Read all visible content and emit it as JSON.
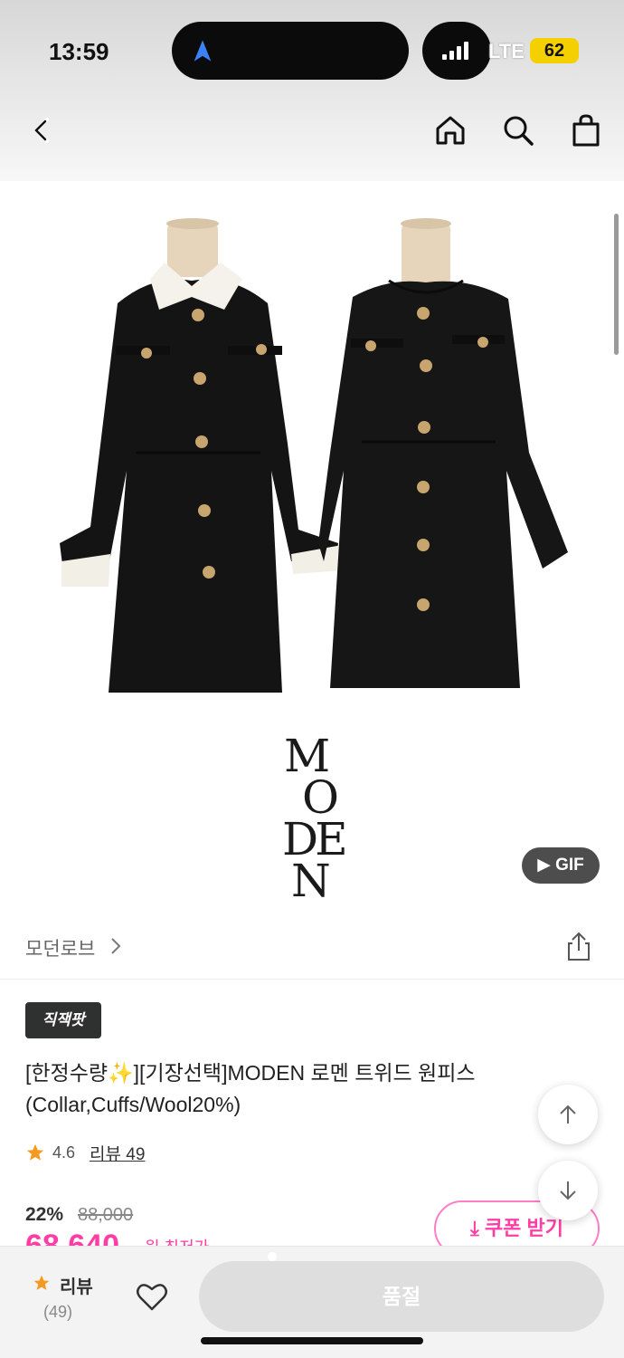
{
  "status_bar": {
    "time": "13:59",
    "network": "LTE",
    "battery": "62",
    "nav_icon": "location-arrow-icon",
    "colors": {
      "battery": "#f5d000",
      "nav": "#3b82f6"
    }
  },
  "header": {
    "icons": [
      "back-icon",
      "home-icon",
      "search-icon",
      "shopping-bag-icon"
    ]
  },
  "image": {
    "logo_lines": [
      "M",
      "O",
      "DE",
      "N"
    ],
    "gif_label": "▶ GIF"
  },
  "brand": {
    "name": "모던로브",
    "share_icon": "share-icon"
  },
  "product": {
    "badge": "직잭팟",
    "title": "[한정수량✨][기장선택]MODEN 로멘 트위드 원피스 (Collar,Cuffs/Wool20%)",
    "rating": "4.6",
    "review_link": "리뷰 49",
    "discount": "22%",
    "original_price": "88,000",
    "sale_price": "68,640",
    "sale_note": "원 최저가",
    "coupon_label": "⤓ 쿠폰 받기",
    "colors": {
      "accent": "#ff3ea5",
      "star": "#f39a1f"
    }
  },
  "bottom_bar": {
    "review_label": "리뷰",
    "review_count": "(49)",
    "buy_label": "품절"
  }
}
